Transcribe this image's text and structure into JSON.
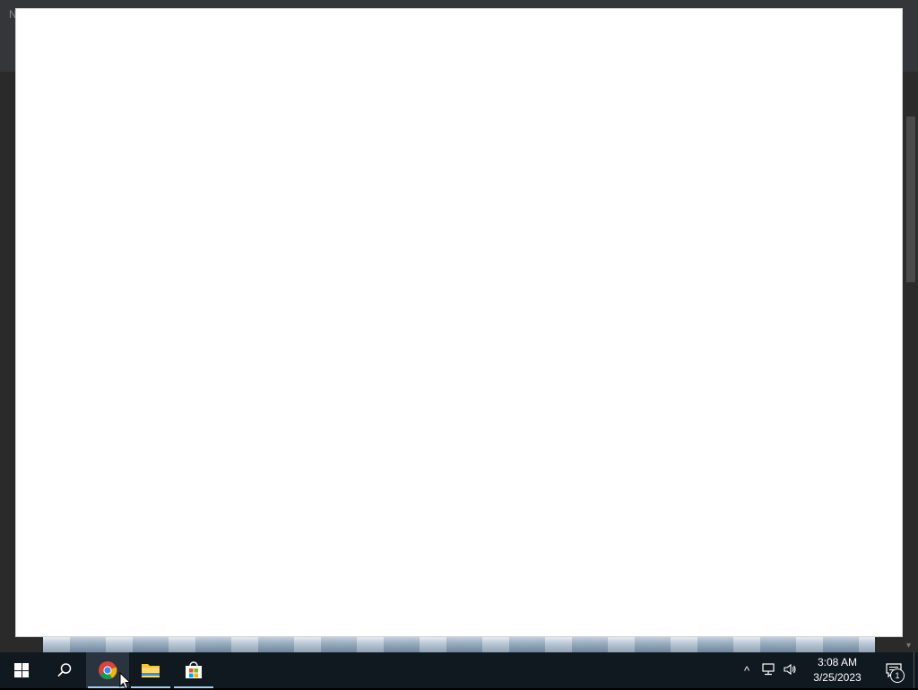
{
  "background_window": {
    "title_initial": "N",
    "more_menu_label": "⋮"
  },
  "popup": {
    "content": ""
  },
  "taskbar": {
    "start_label": "Start",
    "search_label": "Search",
    "apps": [
      {
        "name": "Google Chrome",
        "active": true
      },
      {
        "name": "File Explorer",
        "active": false
      },
      {
        "name": "Microsoft Store",
        "active": false
      }
    ],
    "tray": {
      "overflow_glyph": "^",
      "time": "3:08 AM",
      "date": "3/25/2023",
      "notification_count": "1"
    }
  },
  "colors": {
    "taskbar_bg": "#101820",
    "popup_bg": "#ffffff",
    "active_indicator": "#9fd0f0"
  }
}
